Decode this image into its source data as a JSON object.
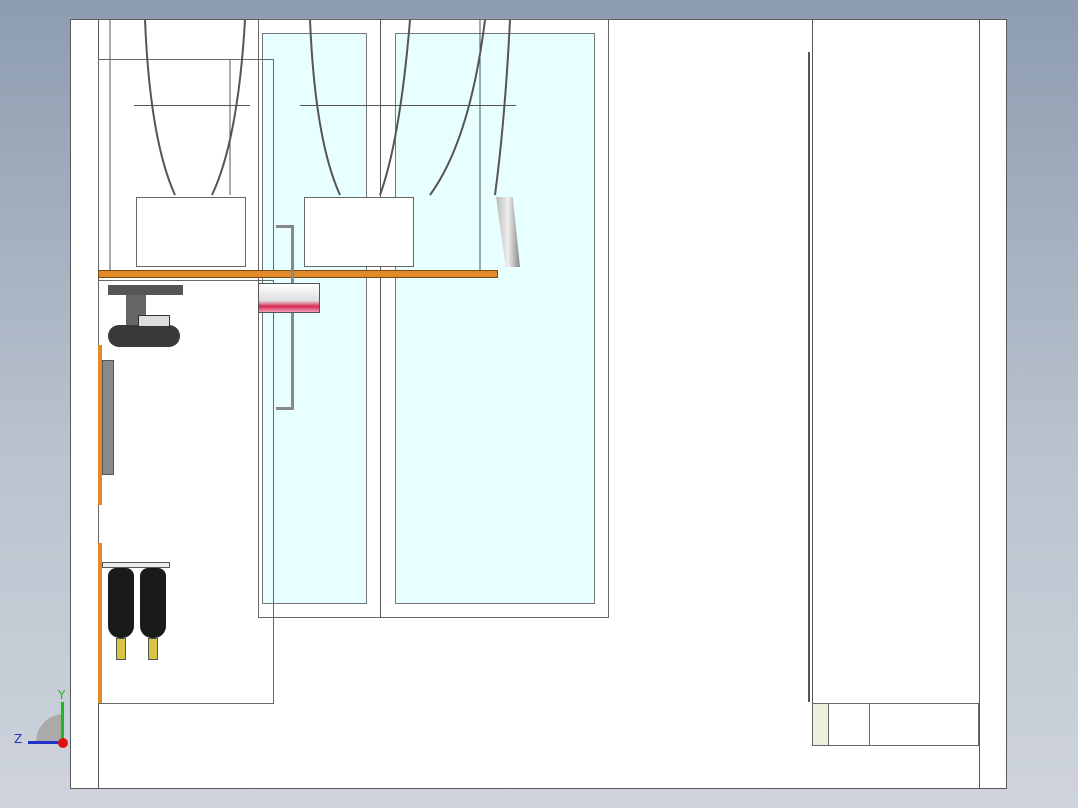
{
  "viewport": {
    "background_top": "#8d9cb0",
    "background_bottom": "#cfd4dc"
  },
  "drawing": {
    "sheet_color": "#ffffff",
    "glass_color": "#e8ffff",
    "shelf_color": "#e08a2a",
    "cylinder_color": "#1a1a1a",
    "valve_color": "#d4c640",
    "accent_red": "#d82850"
  },
  "axis_triad": {
    "y_label": "Y",
    "z_label": "Z",
    "y_color": "#1fb81f",
    "z_color": "#2233cc",
    "origin_color": "#e01010"
  }
}
